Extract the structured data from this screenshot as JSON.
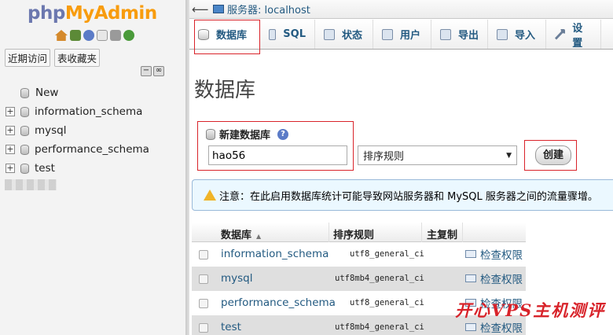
{
  "logo": {
    "php": "php",
    "my": "My",
    "admin": "Admin"
  },
  "nav": {
    "tabs": [
      "近期访问",
      "表收藏夹"
    ],
    "tree": [
      {
        "label": "New"
      },
      {
        "label": "information_schema"
      },
      {
        "label": "mysql"
      },
      {
        "label": "performance_schema"
      },
      {
        "label": "test"
      }
    ]
  },
  "topbar": {
    "breadcrumb": "服务器: localhost"
  },
  "tabs": [
    "数据库",
    "SQL",
    "状态",
    "用户",
    "导出",
    "导入",
    "设置"
  ],
  "main": {
    "title": "数据库",
    "create_label": "新建数据库",
    "db_name_value": "hao56",
    "collation_placeholder": "排序规则",
    "create_button": "创建",
    "notice": "注意：在此启用数据库统计可能导致网站服务器和 MySQL 服务器之间的流量骤增。"
  },
  "table": {
    "headers": [
      "数据库",
      "排序规则",
      "主复制"
    ],
    "rows": [
      {
        "name": "information_schema",
        "collation": "utf8_general_ci",
        "action": "检查权限"
      },
      {
        "name": "mysql",
        "collation": "utf8mb4_general_ci",
        "action": "检查权限"
      },
      {
        "name": "performance_schema",
        "collation": "utf8_general_ci",
        "action": "检查权限"
      },
      {
        "name": "test",
        "collation": "utf8mb4_general_ci",
        "action": "检查权限"
      }
    ]
  },
  "watermark": "开心VPS主机测评",
  "colors": {
    "highlight": "#d9232a",
    "link": "#235a81",
    "notice_bg": "#ebf8ff"
  }
}
